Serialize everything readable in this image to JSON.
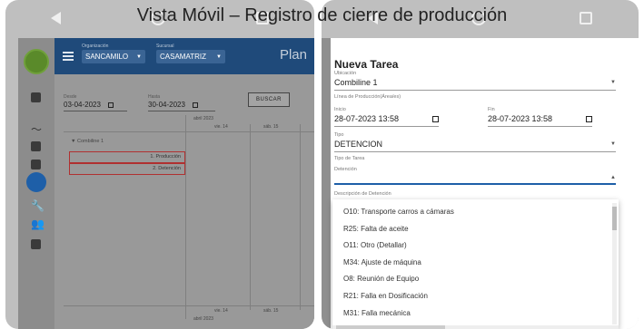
{
  "caption": "Vista Móvil – Registro de cierre de producción",
  "left_app": {
    "topbar": {
      "org_label": "Organización",
      "org_value": "SANCAMILO",
      "suc_label": "Sucursal",
      "suc_value": "CASAMATRIZ",
      "title": "Plan"
    },
    "filters": {
      "desde_label": "Desde",
      "desde_value": "03-04-2023",
      "hasta_label": "Hasta",
      "hasta_value": "30-04-2023",
      "buscar": "BUSCAR"
    },
    "gantt": {
      "month_top": "abril 2023",
      "day1": "vie. 14",
      "day2": "sáb. 15",
      "group": "▼ Combiline 1",
      "row1": "1. Producción",
      "row2": "2. Detención",
      "day1_bottom": "vie. 14",
      "day2_bottom": "sáb. 15",
      "month_bottom": "abril 2023"
    }
  },
  "form": {
    "title": "Nueva Tarea",
    "ubicacion_label": "Ubicación",
    "ubicacion_value": "Combiline 1",
    "linea_label": "Línea de Producción(Área/es)",
    "inicio_label": "Inicio",
    "inicio_value": "28-07-2023 13:58",
    "fin_label": "Fin",
    "fin_value": "28-07-2023 13:58",
    "tipo_label": "Tipo",
    "tipo_value": "DETENCION",
    "tipo_tarea_label": "Tipo de Tarea",
    "detencion_label": "Detención",
    "detencion_value": "",
    "descripcion_label": "Descripción de Detención",
    "options": [
      "O10: Transporte carros a cámaras",
      "R25: Falta de aceite",
      "O11: Otro (Detallar)",
      "M34: Ajuste de máquina",
      "O8: Reunión de Equipo",
      "R21: Falla en Dosificación",
      "M31: Falla mecánica"
    ]
  }
}
